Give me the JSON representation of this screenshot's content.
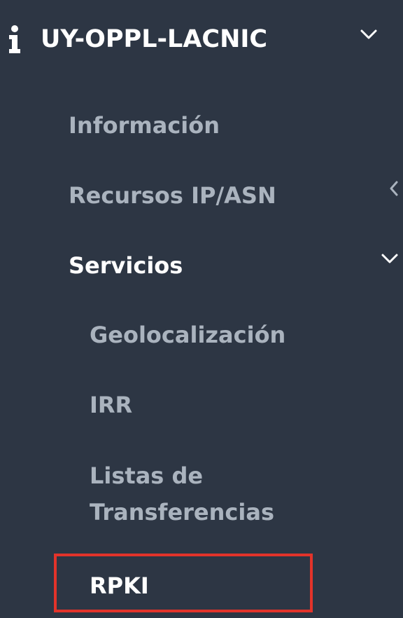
{
  "sidebar": {
    "org": {
      "icon": "info-icon",
      "name": "UY-OPPL-LACNIC",
      "chevron": "chevron-down-icon"
    },
    "items": [
      {
        "label": "Información",
        "level": 1
      },
      {
        "label": "Recursos IP/ASN",
        "level": 1,
        "chevron": "chevron-left-icon"
      },
      {
        "label": "Servicios",
        "level": 1,
        "active": true,
        "chevron": "chevron-down-icon"
      }
    ],
    "subitems": [
      {
        "label": "Geolocalización"
      },
      {
        "label": "IRR"
      },
      {
        "label_line1": "Listas de",
        "label_line2": "Transferencias"
      },
      {
        "label": "RPKI",
        "active": true,
        "highlighted": true
      }
    ],
    "colors": {
      "background": "#2d3644",
      "text_muted": "#aab3be",
      "text_active": "#ffffff",
      "highlight_border": "#e2332a"
    }
  }
}
